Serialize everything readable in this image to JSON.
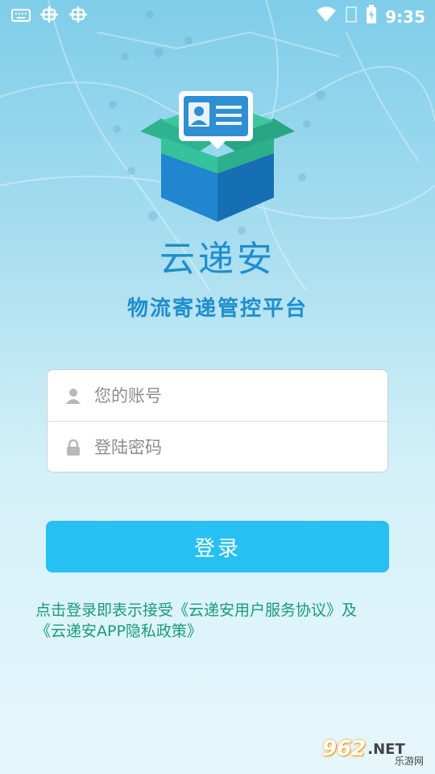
{
  "status_bar": {
    "time": "9:35",
    "icons": [
      "keyboard-icon",
      "bug-icon",
      "bug-icon",
      "wifi-icon",
      "signal-icon",
      "battery-charging-icon"
    ]
  },
  "app": {
    "name": "云递安",
    "subtitle": "物流寄递管控平台"
  },
  "login": {
    "account_placeholder": "您的账号",
    "password_placeholder": "登陆密码",
    "button_label": "登录"
  },
  "agreement": {
    "prefix": "点击登录即表示接受",
    "user_agreement": "《云递安用户服务协议》",
    "connector": "及",
    "privacy_policy": "《云递安APP隐私政策》"
  },
  "watermark": {
    "main": "962",
    "net": ".NET",
    "sub": "乐游网"
  },
  "colors": {
    "primary_text": "#1f8ecd",
    "button": "#27c0f2",
    "agreement_text": "#1c9b78"
  }
}
